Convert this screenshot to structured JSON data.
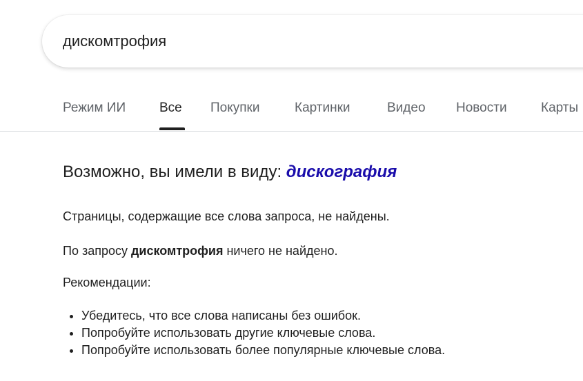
{
  "search": {
    "query": "дискомтрофия"
  },
  "tabs": [
    {
      "label": "Режим ИИ"
    },
    {
      "label": "Все"
    },
    {
      "label": "Покупки"
    },
    {
      "label": "Картинки"
    },
    {
      "label": "Видео"
    },
    {
      "label": "Новости"
    },
    {
      "label": "Карты"
    }
  ],
  "results": {
    "did_you_mean_prefix": "Возможно, вы имели в виду: ",
    "did_you_mean_suggestion": "дискография",
    "no_pages_text": "Страницы, содержащие все слова запроса, не найдены.",
    "no_results_prefix": "По запросу ",
    "no_results_query": "дискомтрофия",
    "no_results_suffix": " ничего не найдено.",
    "recommendations_title": "Рекомендации:",
    "recommendations": [
      "Убедитесь, что все слова написаны без ошибок.",
      "Попробуйте использовать другие ключевые слова.",
      "Попробуйте использовать более популярные ключевые слова."
    ]
  },
  "colors": {
    "link": "#1a0dab",
    "text": "#1f1f1f",
    "tab_inactive": "#5f6368"
  }
}
